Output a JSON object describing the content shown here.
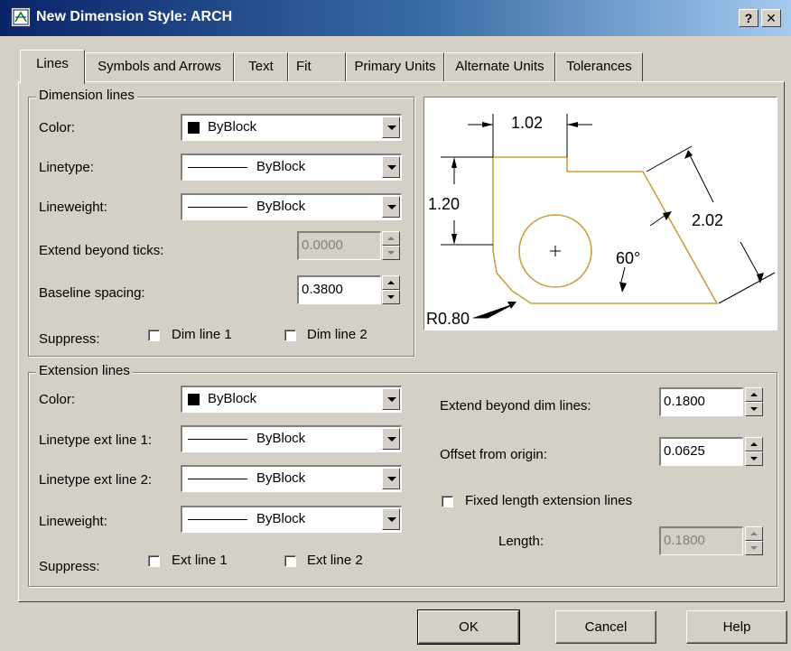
{
  "window": {
    "title": "New Dimension Style: ARCH",
    "help_glyph": "?",
    "close_glyph": "✕"
  },
  "tabs": [
    {
      "label": "Lines",
      "active": true
    },
    {
      "label": "Symbols and Arrows"
    },
    {
      "label": "Text"
    },
    {
      "label": "Fit"
    },
    {
      "label": "Primary Units"
    },
    {
      "label": "Alternate Units"
    },
    {
      "label": "Tolerances"
    }
  ],
  "dimension_lines": {
    "legend": "Dimension lines",
    "color_label": "Color:",
    "color_value": "ByBlock",
    "linetype_label": "Linetype:",
    "linetype_value": "ByBlock",
    "lineweight_label": "Lineweight:",
    "lineweight_value": "ByBlock",
    "extend_ticks_label": "Extend beyond ticks:",
    "extend_ticks_value": "0.0000",
    "baseline_label": "Baseline spacing:",
    "baseline_value": "0.3800",
    "suppress_label": "Suppress:",
    "dim_line_1": "Dim line 1",
    "dim_line_2": "Dim line 2"
  },
  "extension_lines": {
    "legend": "Extension lines",
    "color_label": "Color:",
    "color_value": "ByBlock",
    "linetype1_label": "Linetype ext line 1:",
    "linetype1_value": "ByBlock",
    "linetype2_label": "Linetype ext line 2:",
    "linetype2_value": "ByBlock",
    "lineweight_label": "Lineweight:",
    "lineweight_value": "ByBlock",
    "suppress_label": "Suppress:",
    "ext_line_1": "Ext line 1",
    "ext_line_2": "Ext line 2",
    "extend_dim_label": "Extend beyond dim lines:",
    "extend_dim_value": "0.1800",
    "offset_label": "Offset from origin:",
    "offset_value": "0.0625",
    "fixed_length_label": "Fixed length extension lines",
    "length_label": "Length:",
    "length_value": "0.1800"
  },
  "preview": {
    "dim_top": "1.02",
    "dim_left": "1.20",
    "dim_right": "2.02",
    "angle": "60°",
    "radius": "R0.80",
    "shape_color": "#c8a040"
  },
  "buttons": {
    "ok": "OK",
    "cancel": "Cancel",
    "help": "Help"
  },
  "colors": {
    "titlebar": "#0a246a",
    "face": "#d4d0c8"
  }
}
